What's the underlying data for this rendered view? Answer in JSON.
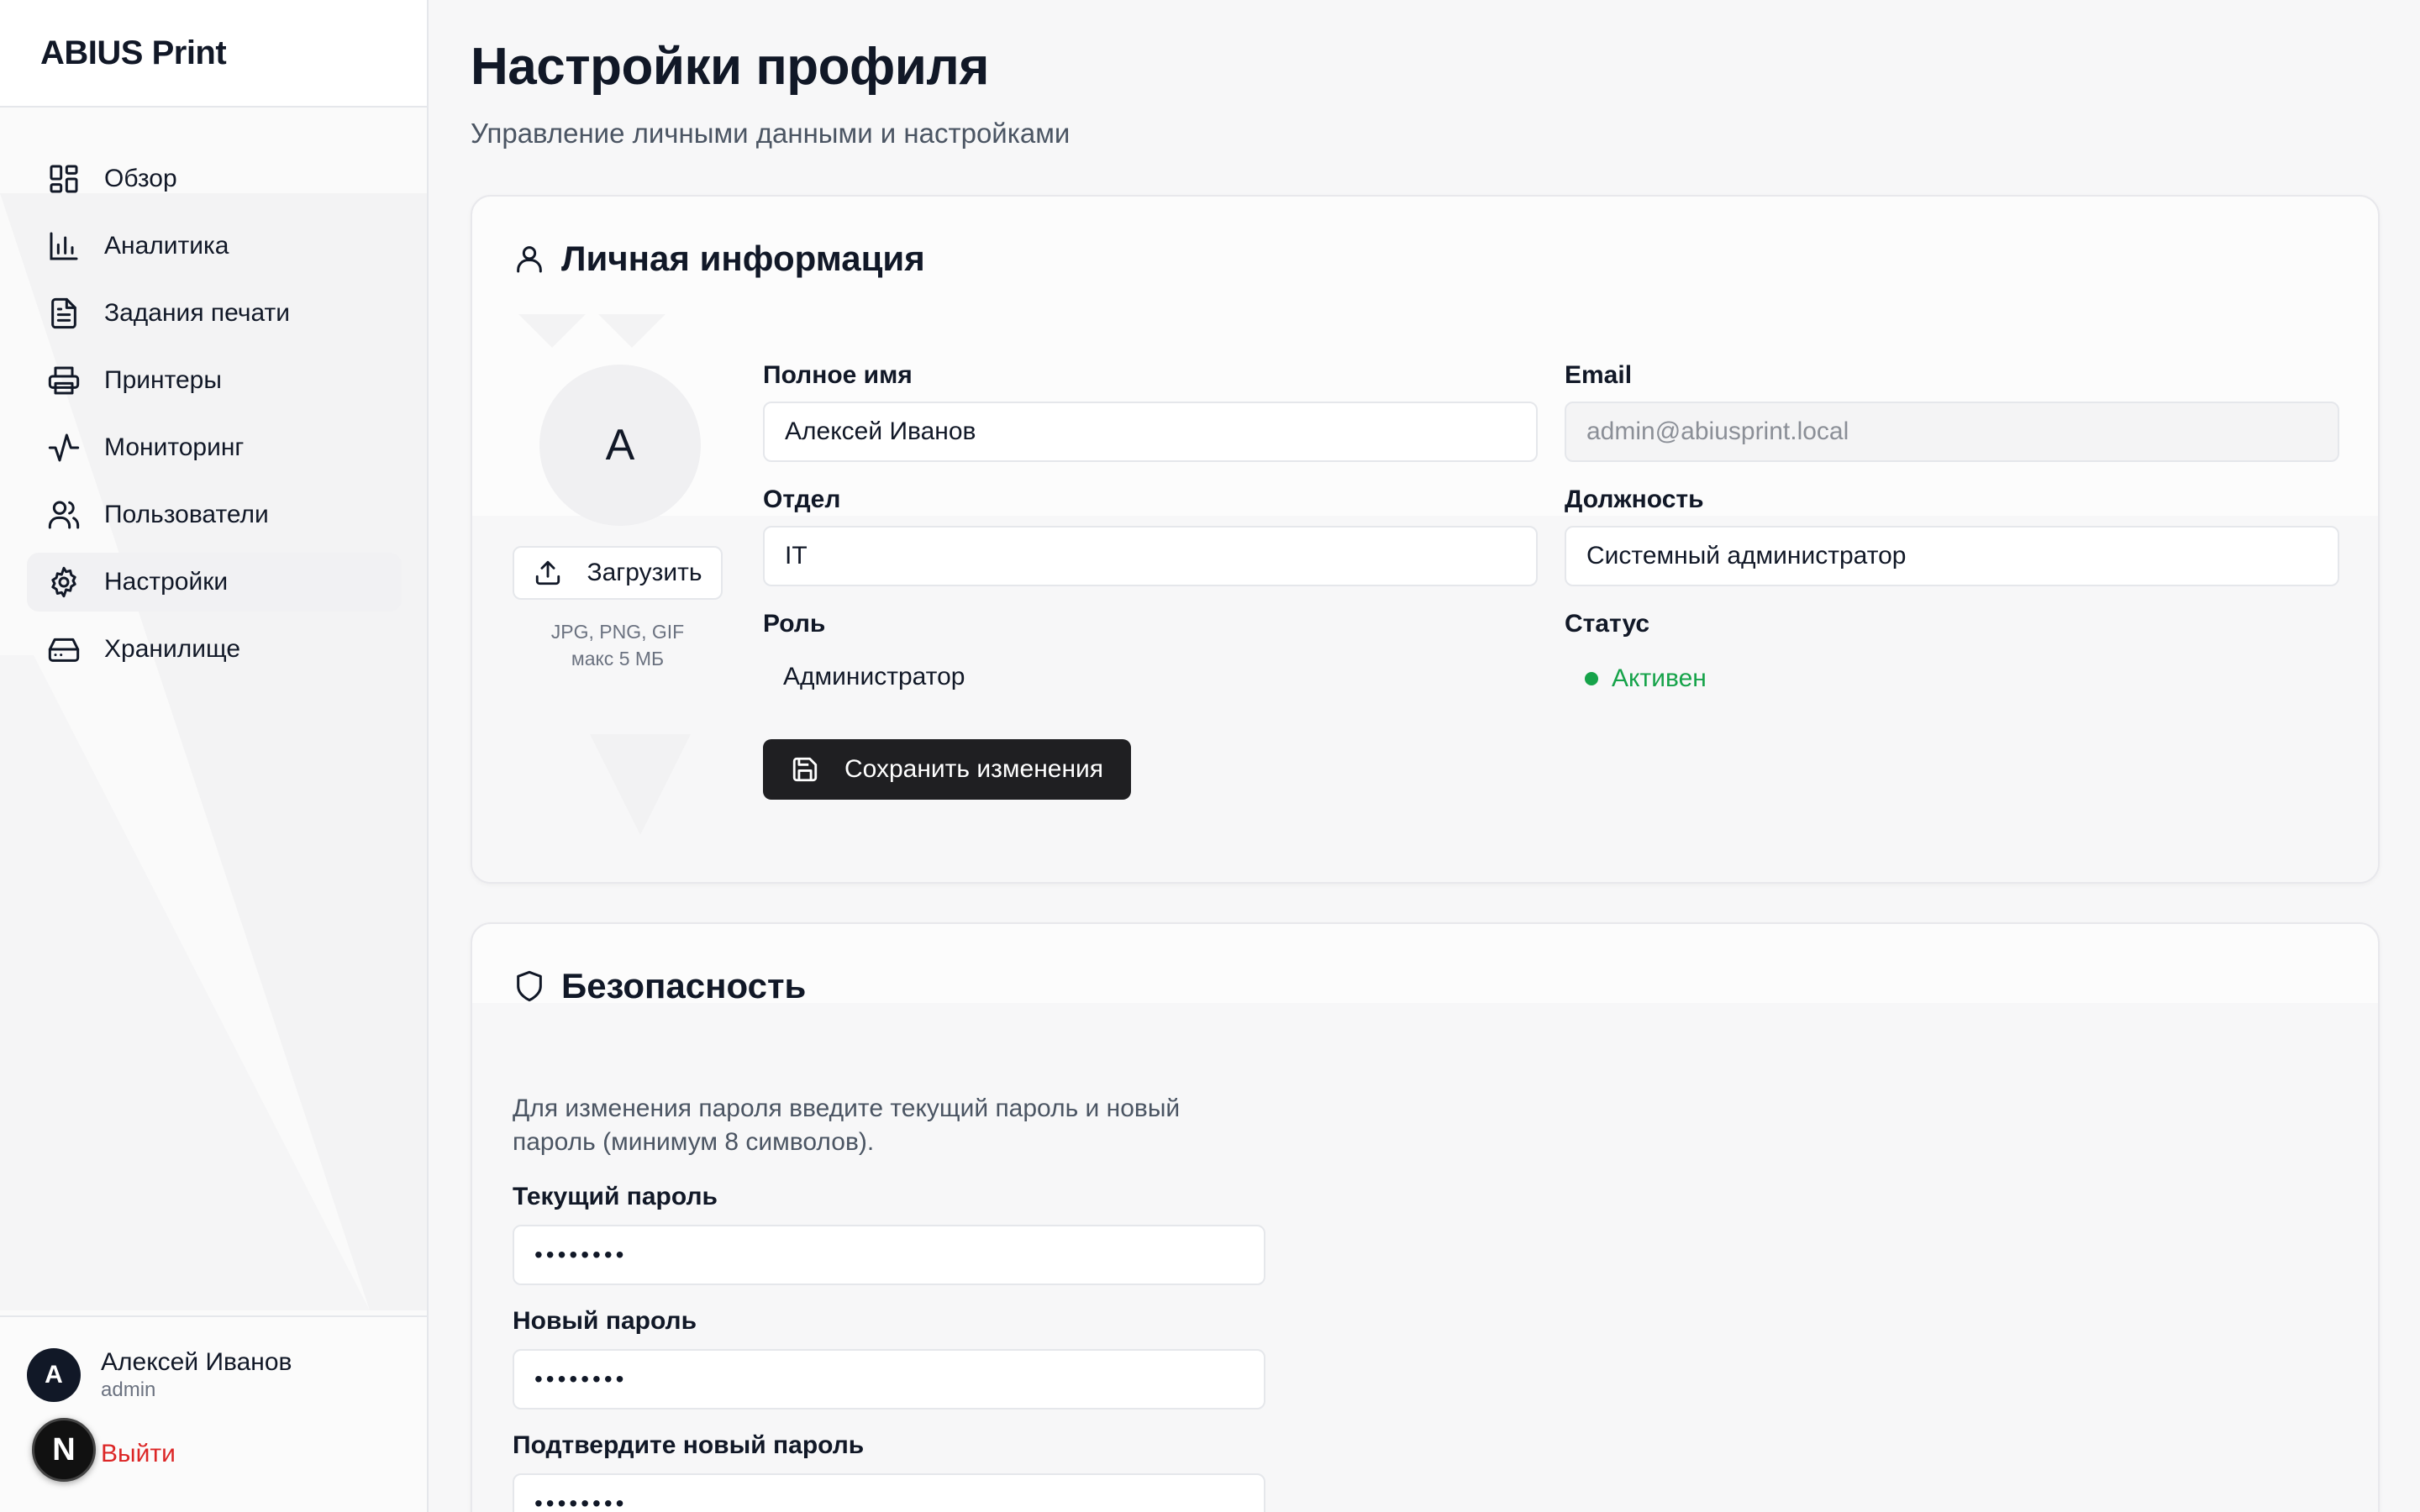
{
  "app": {
    "brand": "ABIUS Print"
  },
  "sidebar": {
    "items": [
      {
        "label": "Обзор",
        "icon": "dashboard-icon",
        "active": false
      },
      {
        "label": "Аналитика",
        "icon": "bar-chart-icon",
        "active": false
      },
      {
        "label": "Задания печати",
        "icon": "document-icon",
        "active": false
      },
      {
        "label": "Принтеры",
        "icon": "printer-icon",
        "active": false
      },
      {
        "label": "Мониторинг",
        "icon": "activity-icon",
        "active": false
      },
      {
        "label": "Пользователи",
        "icon": "users-icon",
        "active": false
      },
      {
        "label": "Настройки",
        "icon": "gear-icon",
        "active": true
      },
      {
        "label": "Хранилище",
        "icon": "hard-drive-icon",
        "active": false
      }
    ],
    "user": {
      "initial": "A",
      "name": "Алексей Иванов",
      "login": "admin"
    },
    "logout_label": "Выйти",
    "dev_badge": "N"
  },
  "header": {
    "title": "Настройки профиля",
    "subtitle": "Управление личными данными и настройками"
  },
  "personal": {
    "title": "Личная информация",
    "avatar_initial": "A",
    "upload_label": "Загрузить",
    "upload_hint_1": "JPG, PNG, GIF",
    "upload_hint_2": "макс 5 МБ",
    "full_name_label": "Полное имя",
    "full_name_value": "Алексей Иванов",
    "email_label": "Email",
    "email_value": "admin@abiusprint.local",
    "department_label": "Отдел",
    "department_value": "IT",
    "position_label": "Должность",
    "position_value": "Системный администратор",
    "role_label": "Роль",
    "role_value": "Администратор",
    "status_label": "Статус",
    "status_value": "Активен",
    "save_label": "Сохранить изменения"
  },
  "security": {
    "title": "Безопасность",
    "description": "Для изменения пароля введите текущий пароль и новый пароль (минимум 8 символов).",
    "current_password_label": "Текущий пароль",
    "new_password_label": "Новый пароль",
    "confirm_password_label": "Подтвердите новый пароль",
    "masked_value": "••••••••"
  },
  "colors": {
    "accent": "#1f1f22",
    "status_active": "#16a34a",
    "logout": "#dc2626",
    "border": "#e5e7eb"
  }
}
